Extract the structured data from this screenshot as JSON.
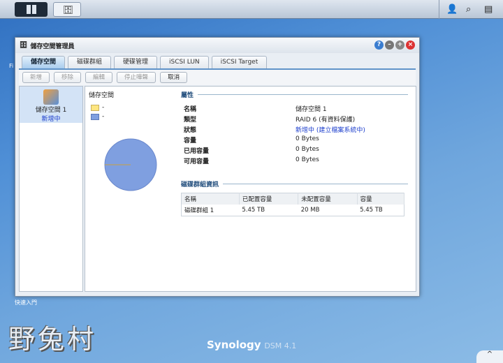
{
  "taskbar": {
    "icons": [
      "main-menu-icon",
      "storage-manager-icon",
      "user-icon",
      "search-icon",
      "widgets-icon"
    ]
  },
  "desktop": {
    "quick_start": "快速入門",
    "watermark": "野兔村",
    "brand": "Synology",
    "brand_version": "DSM 4.1",
    "fi": "Fi"
  },
  "window": {
    "title": "儲存空間管理員",
    "tabs": [
      "儲存空間",
      "磁碟群組",
      "硬碟管理",
      "iSCSI LUN",
      "iSCSI Target"
    ],
    "toolbar": [
      "新增",
      "移除",
      "編輯",
      "停止嘩聲",
      "取消"
    ],
    "volume": {
      "name": "儲存空間 1",
      "status": "新增中"
    },
    "chart_title": "儲存空間",
    "legend": [
      "-",
      "-"
    ],
    "colors": {
      "used": "#ffe680",
      "free": "#7f9fe0",
      "status": "#1a3ccc"
    },
    "properties_title": "屬性",
    "properties": [
      {
        "label": "名稱",
        "value": "儲存空間 1"
      },
      {
        "label": "類型",
        "value": "RAID 6 (有資料保護)"
      },
      {
        "label": "狀態",
        "value": "新增中 (建立檔案系統中)"
      },
      {
        "label": "容量",
        "value": "0 Bytes"
      },
      {
        "label": "已用容量",
        "value": "0 Bytes"
      },
      {
        "label": "可用容量",
        "value": "0 Bytes"
      }
    ],
    "diskgroup_title": "磁碟群組資訊",
    "table": {
      "headers": [
        "名稱",
        "已配置容量",
        "未配置容量",
        "容量"
      ],
      "rows": [
        [
          "磁碟群組 1",
          "5.45 TB",
          "20 MB",
          "5.45 TB"
        ]
      ]
    }
  }
}
